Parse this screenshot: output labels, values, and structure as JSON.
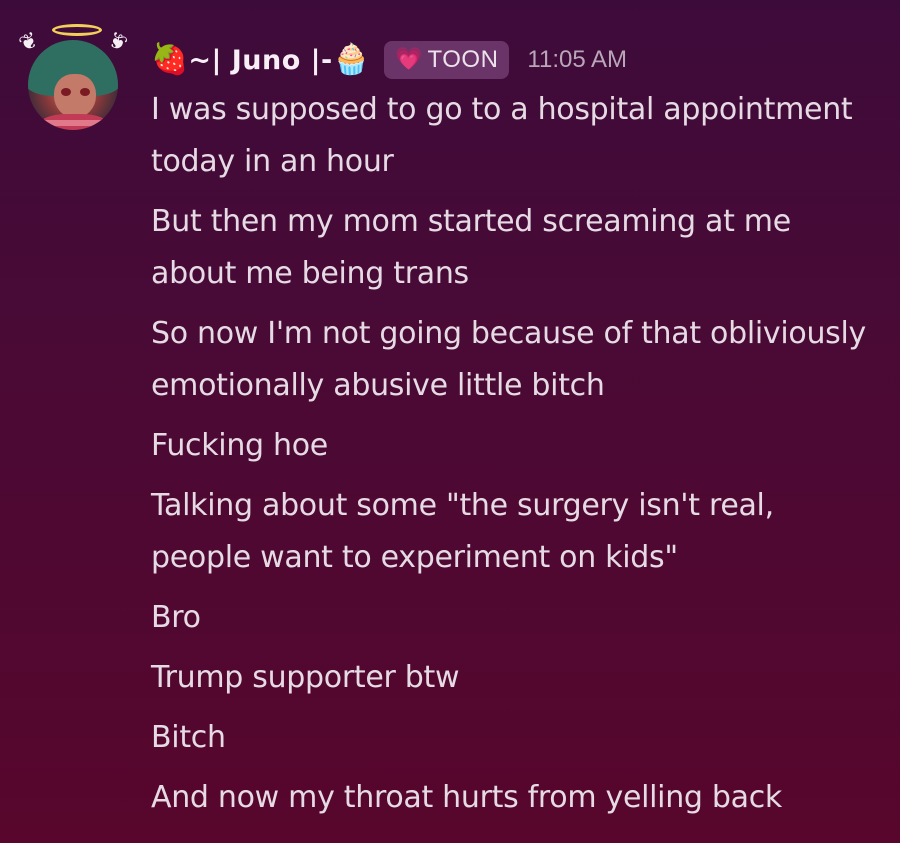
{
  "message": {
    "author": {
      "name": "~| Juno |-",
      "prefix_emoji": "🍓",
      "suffix_emoji": "🧁",
      "tag_icon": "💗",
      "tag_label": "TOON",
      "avatar_icon": "avatar-image"
    },
    "timestamp": "11:05 AM",
    "lines": [
      "I was supposed to go to a hospital appointment today in an hour",
      "But then my mom started screaming at me about me being trans",
      "So now I'm not going because of that obliviously emotionally abusive little bitch",
      "Fucking hoe",
      "Talking about some \"the surgery isn't real, people want to experiment on kids\"",
      "Bro",
      "Trump supporter btw",
      "Bitch",
      "And now my throat hurts from yelling back"
    ]
  },
  "colors": {
    "background_top": "#3d0b3a",
    "background_bottom": "#58062c",
    "text": "#e6dbe4",
    "username": "#f7eef6",
    "tag_bg": "#6a3468",
    "timestamp": "#b9a6b8"
  }
}
